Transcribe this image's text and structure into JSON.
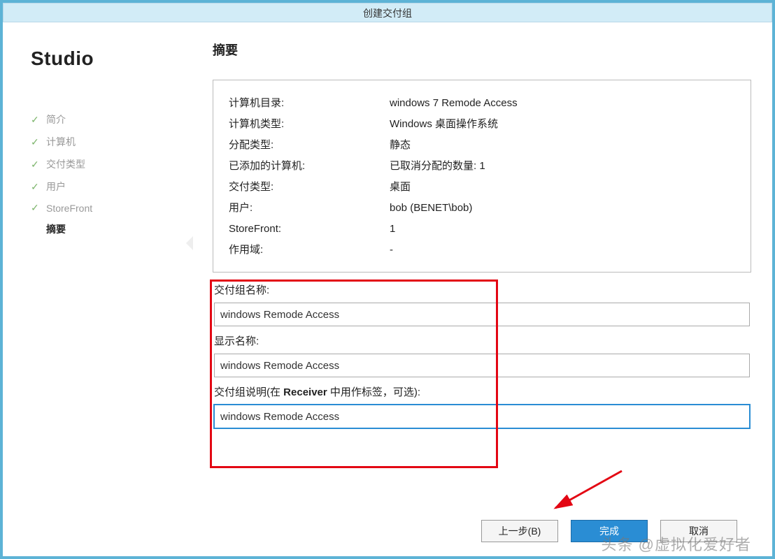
{
  "title": "创建交付组",
  "sidebar": {
    "logo": "Studio",
    "steps": [
      {
        "label": "简介",
        "done": true
      },
      {
        "label": "计算机",
        "done": true
      },
      {
        "label": "交付类型",
        "done": true
      },
      {
        "label": "用户",
        "done": true
      },
      {
        "label": "StoreFront",
        "done": true
      },
      {
        "label": "摘要",
        "done": false,
        "current": true
      }
    ]
  },
  "main": {
    "heading": "摘要",
    "summary": [
      {
        "k": "计算机目录:",
        "v": "windows 7 Remode Access"
      },
      {
        "k": "计算机类型:",
        "v": "Windows 桌面操作系统"
      },
      {
        "k": "分配类型:",
        "v": "静态"
      },
      {
        "k": "已添加的计算机:",
        "v": "已取消分配的数量: 1"
      },
      {
        "k": "交付类型:",
        "v": "桌面"
      },
      {
        "k": "用户:",
        "v": "bob (BENET\\bob)"
      },
      {
        "k": "StoreFront:",
        "v": "1"
      },
      {
        "k": "作用域:",
        "v": "-"
      }
    ],
    "form": {
      "name_label": "交付组名称:",
      "name_value": "windows Remode Access",
      "display_label": "显示名称:",
      "display_value": "windows Remode Access",
      "desc_label_pre": "交付组说明(在 ",
      "desc_label_bold": "Receiver",
      "desc_label_post": " 中用作标签，可选):",
      "desc_value": "windows Remode Access"
    },
    "buttons": {
      "back": "上一步(B)",
      "finish": "完成",
      "cancel": "取消"
    }
  },
  "watermark": "头条 @虚拟化爱好者"
}
